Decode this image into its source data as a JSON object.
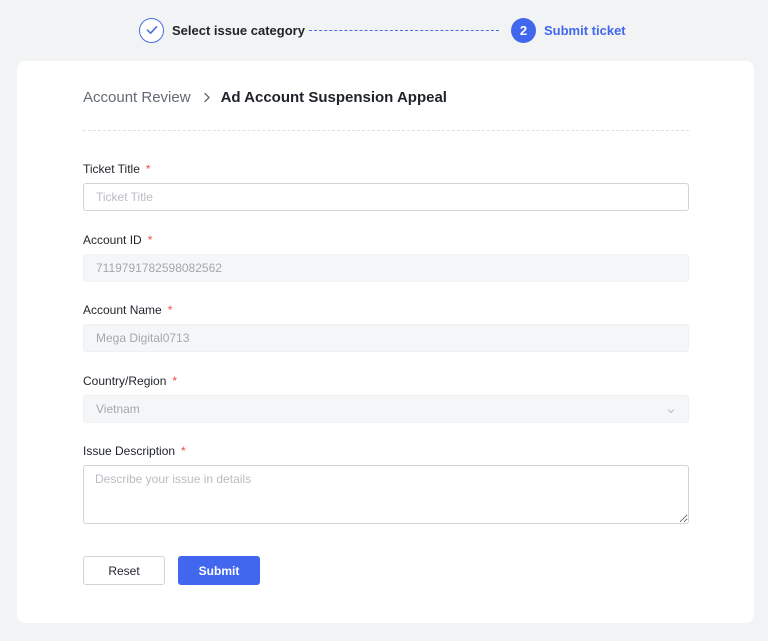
{
  "stepper": {
    "steps": [
      {
        "label": "Select issue category",
        "state": "completed"
      },
      {
        "number": "2",
        "label": "Submit ticket",
        "state": "active"
      }
    ]
  },
  "breadcrumb": {
    "parent": "Account Review",
    "current": "Ad Account Suspension Appeal"
  },
  "form": {
    "ticket_title": {
      "label": "Ticket Title",
      "placeholder": "Ticket Title",
      "value": ""
    },
    "account_id": {
      "label": "Account ID",
      "value": "7119791782598082562"
    },
    "account_name": {
      "label": "Account Name",
      "value": "Mega Digital0713"
    },
    "country_region": {
      "label": "Country/Region",
      "value": "Vietnam"
    },
    "issue_description": {
      "label": "Issue Description",
      "placeholder": "Describe your issue in details",
      "value": ""
    },
    "required_mark": "*"
  },
  "buttons": {
    "reset": "Reset",
    "submit": "Submit"
  },
  "colors": {
    "primary": "#4167ef",
    "required": "#f54a45",
    "background": "#f2f3f5"
  }
}
